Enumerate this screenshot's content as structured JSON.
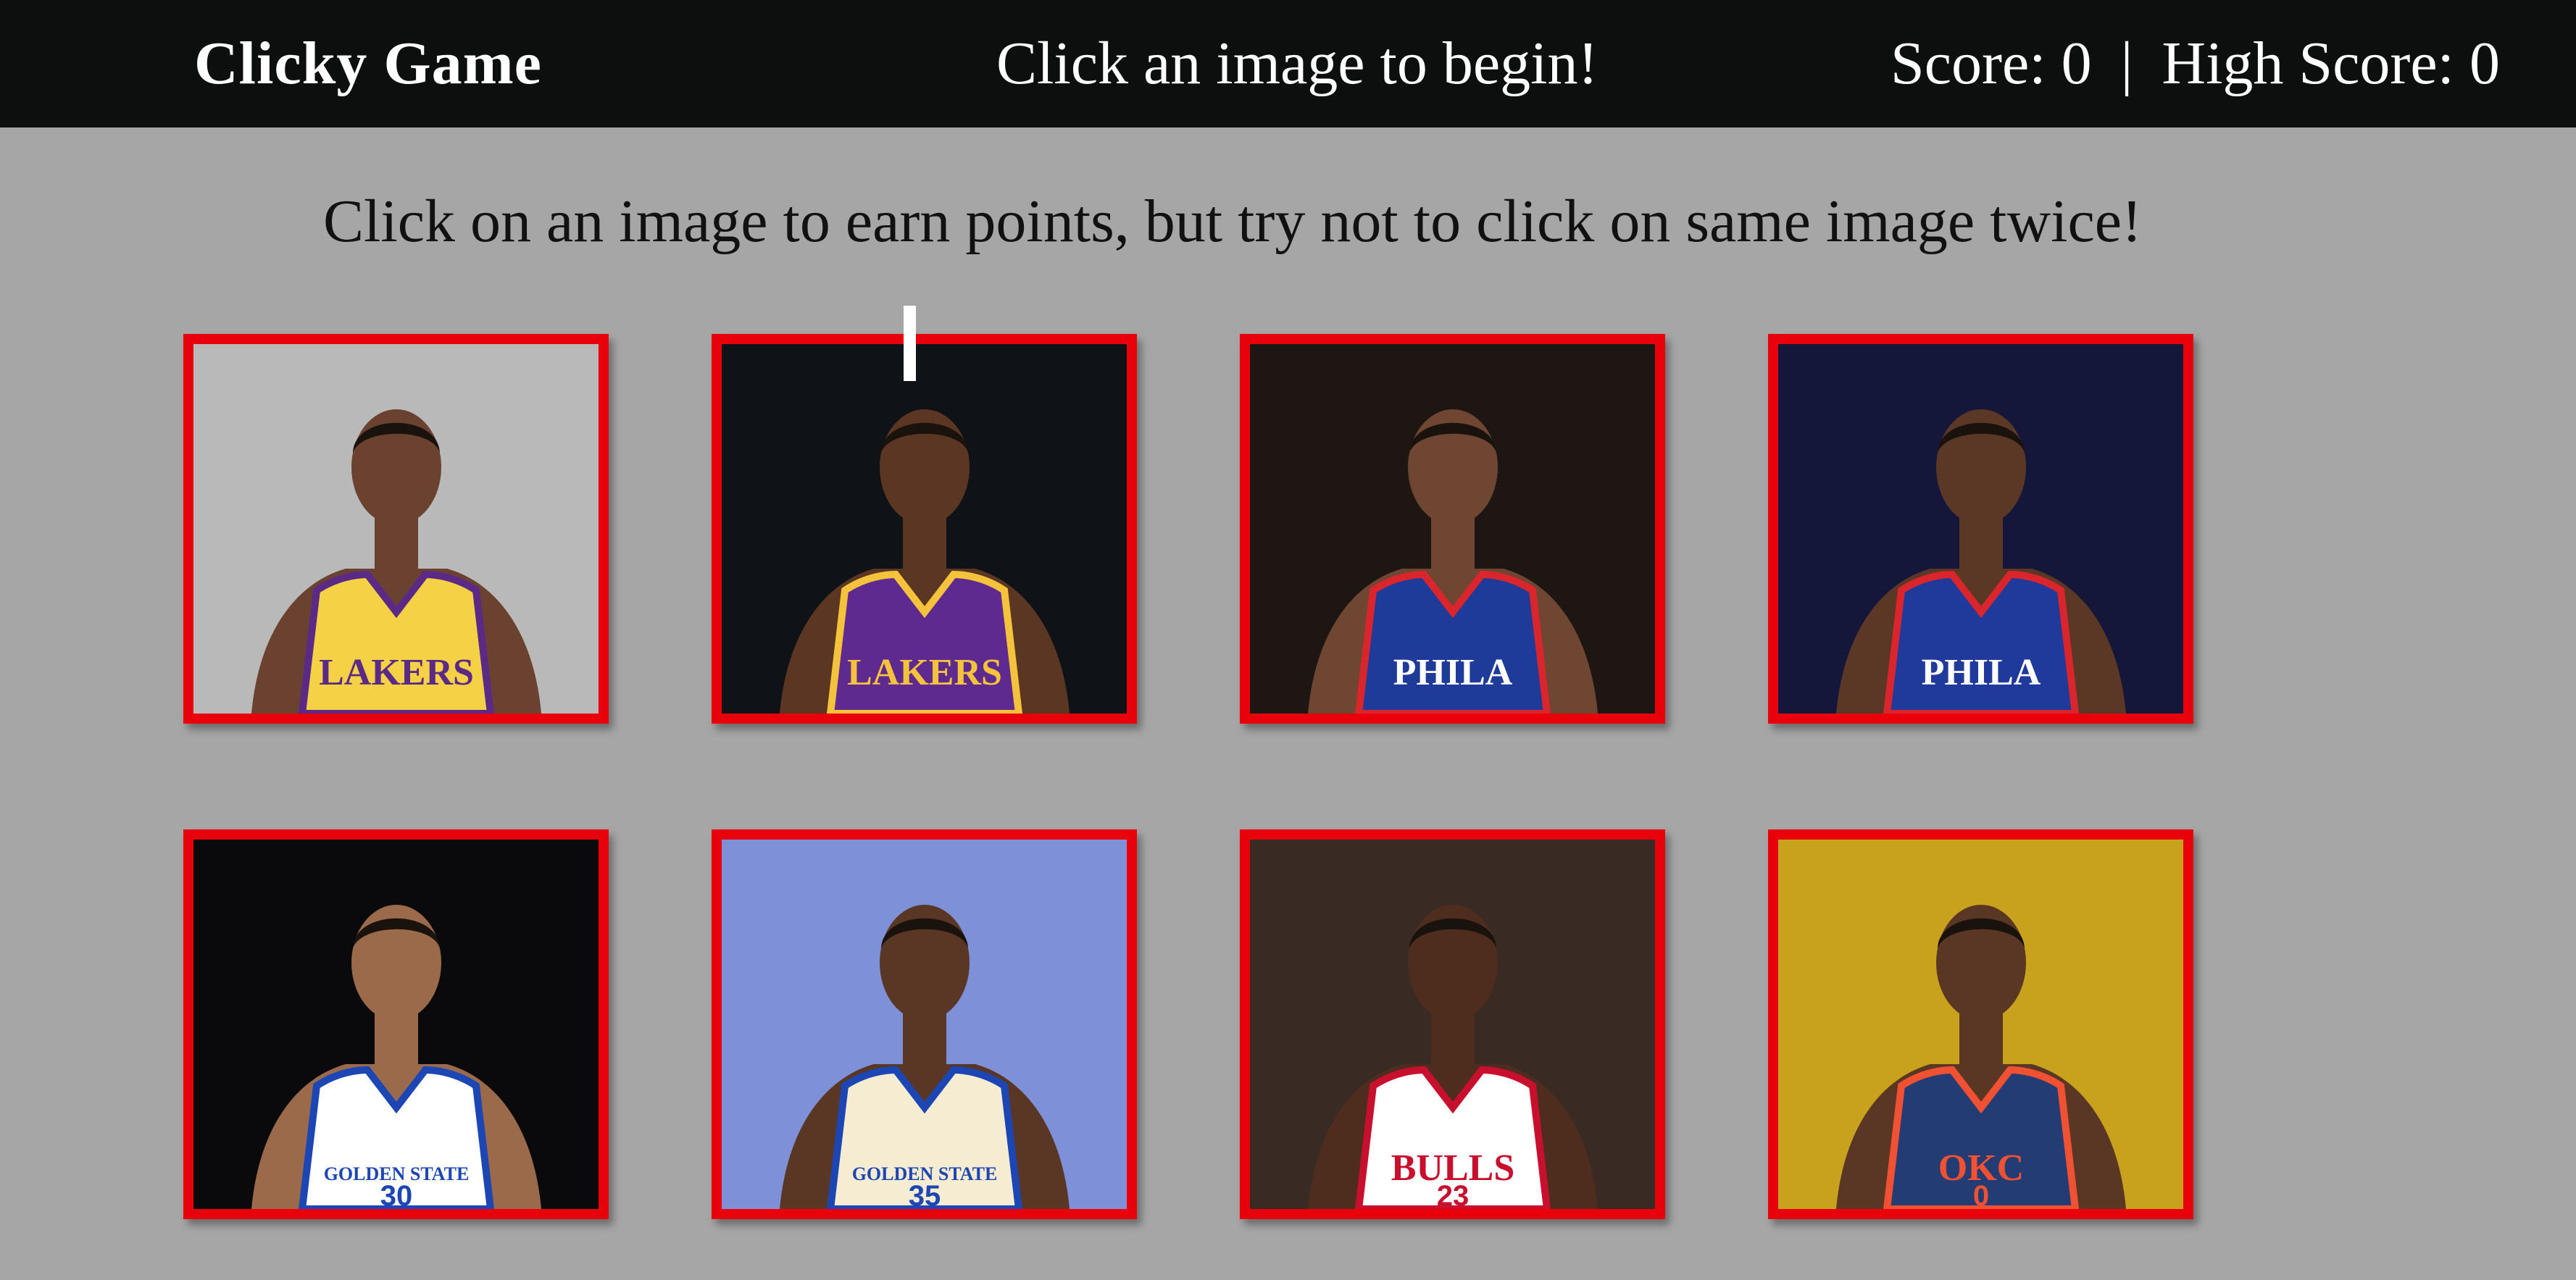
{
  "navbar": {
    "brand": "Clicky Game",
    "status": "Click an image to begin!",
    "score_label": "Score:",
    "score": "0",
    "separator": "|",
    "high_score_label": "High Score:",
    "high_score": "0"
  },
  "instructions": "Click on an image to earn points, but try not to click on same image twice!",
  "cards": [
    {
      "name": "lebron-james",
      "jersey_text": "LAKERS",
      "number": "",
      "bg": "#b9b9b9",
      "jersey": "#f5d146",
      "trim": "#5b2a86",
      "text_color": "#5b2a86",
      "skin": "#6b4230"
    },
    {
      "name": "kobe-bryant",
      "jersey_text": "LAKERS",
      "number": "",
      "bg": "#0f1216",
      "jersey": "#5e2a90",
      "trim": "#f5c23c",
      "text_color": "#f5c23c",
      "skin": "#5a3623"
    },
    {
      "name": "ben-simmons",
      "jersey_text": "PHILA",
      "number": "",
      "bg": "#1e1613",
      "jersey": "#1e3b9a",
      "trim": "#d9252b",
      "text_color": "#ffffff",
      "skin": "#6e4632"
    },
    {
      "name": "jimmy-butler",
      "jersey_text": "PHILA",
      "number": "",
      "bg": "#14163a",
      "jersey": "#1f3a9b",
      "trim": "#d9252b",
      "text_color": "#ffffff",
      "skin": "#5b3826"
    },
    {
      "name": "stephen-curry",
      "jersey_text": "GOLDEN STATE",
      "number": "30",
      "bg": "#0a0a0c",
      "jersey": "#ffffff",
      "trim": "#1d46b5",
      "text_color": "#1d46b5",
      "skin": "#9a6a4a"
    },
    {
      "name": "kevin-durant",
      "jersey_text": "GOLDEN STATE",
      "number": "35",
      "bg": "#7e90d8",
      "jersey": "#f5ecd2",
      "trim": "#1d46b5",
      "text_color": "#1d46b5",
      "skin": "#5a3624"
    },
    {
      "name": "michael-jordan",
      "jersey_text": "BULLS",
      "number": "23",
      "bg": "#3a2a24",
      "jersey": "#ffffff",
      "trim": "#c8102e",
      "text_color": "#c8102e",
      "skin": "#4e2d1f"
    },
    {
      "name": "russell-westbrook",
      "jersey_text": "OKC",
      "number": "0",
      "bg": "#c9a21d",
      "jersey": "#233c73",
      "trim": "#f05133",
      "text_color": "#f05133",
      "skin": "#5a3624"
    }
  ]
}
